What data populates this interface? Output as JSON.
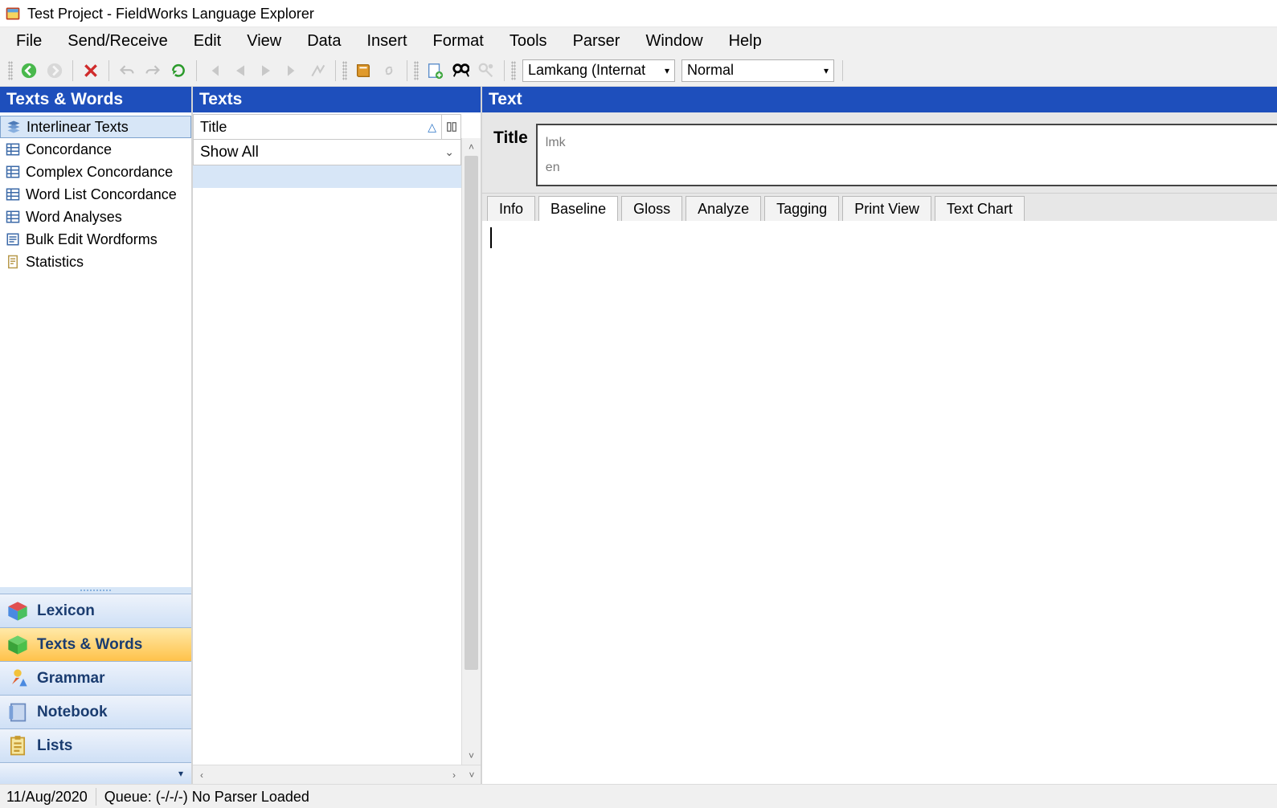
{
  "window": {
    "title": "Test Project - FieldWorks Language Explorer"
  },
  "menubar": [
    "File",
    "Send/Receive",
    "Edit",
    "View",
    "Data",
    "Insert",
    "Format",
    "Tools",
    "Parser",
    "Window",
    "Help"
  ],
  "toolbar": {
    "language_combo": "Lamkang (Internat",
    "style_combo": "Normal"
  },
  "left_panel": {
    "title": "Texts & Words",
    "items": [
      "Interlinear Texts",
      "Concordance",
      "Complex Concordance",
      "Word List Concordance",
      "Word Analyses",
      "Bulk Edit Wordforms",
      "Statistics"
    ],
    "selected_index": 0,
    "sections": [
      {
        "label": "Lexicon"
      },
      {
        "label": "Texts & Words"
      },
      {
        "label": "Grammar"
      },
      {
        "label": "Notebook"
      },
      {
        "label": "Lists"
      }
    ],
    "active_section_index": 1
  },
  "mid_panel": {
    "title": "Texts",
    "column_header": "Title",
    "filter_value": "Show All"
  },
  "right_panel": {
    "title": "Text",
    "title_label": "Title",
    "title_lines": {
      "ws1": "lmk",
      "ws2": "en"
    },
    "tabs": [
      "Info",
      "Baseline",
      "Gloss",
      "Analyze",
      "Tagging",
      "Print View",
      "Text Chart"
    ],
    "active_tab_index": 1
  },
  "statusbar": {
    "date": "11/Aug/2020",
    "queue": "Queue: (-/-/-) No Parser Loaded"
  }
}
